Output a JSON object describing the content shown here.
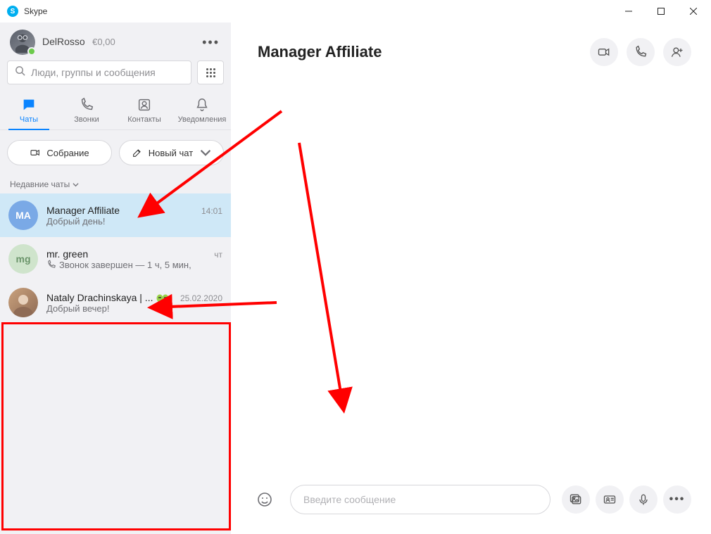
{
  "app": {
    "title": "Skype"
  },
  "profile": {
    "name": "DelRosso",
    "balance": "€0,00"
  },
  "search": {
    "placeholder": "Люди, группы и сообщения"
  },
  "tabs": {
    "chats": "Чаты",
    "calls": "Звонки",
    "contacts": "Контакты",
    "notifications": "Уведомления"
  },
  "actions": {
    "meeting": "Собрание",
    "new_chat": "Новый чат"
  },
  "section": {
    "recent": "Недавние чаты"
  },
  "chats": [
    {
      "initials": "MA",
      "name": "Manager Affiliate",
      "preview": "Добрый день!",
      "time": "14:01"
    },
    {
      "initials": "mg",
      "name": "mr. green",
      "preview": "Звонок завершен — 1 ч, 5 мин,",
      "time": "чт"
    },
    {
      "initials": "",
      "name": "Nataly Drachinskaya | ...",
      "preview": "Добрый вечер!",
      "time": "25.02.2020"
    }
  ],
  "conversation": {
    "title": "Manager Affiliate"
  },
  "composer": {
    "placeholder": "Введите сообщение"
  }
}
